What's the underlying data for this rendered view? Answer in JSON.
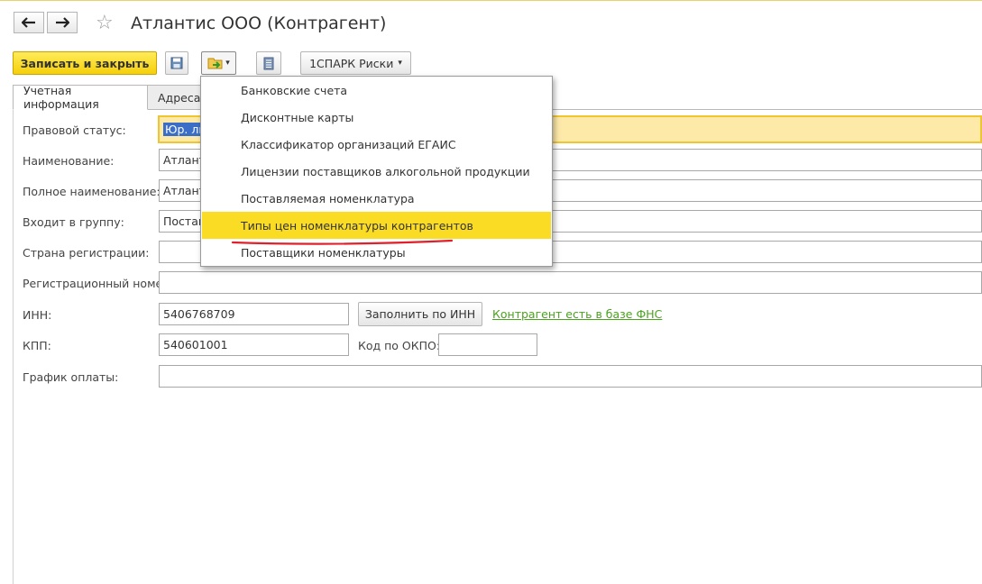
{
  "window": {
    "title": "Атлантис ООО (Контрагент)"
  },
  "nav": {
    "back": "🡐",
    "forward": "🡒"
  },
  "toolbar": {
    "save_close": "Записать и закрыть",
    "spark": "1СПАРК Риски",
    "dropdown_arrow": "▾"
  },
  "tabs": [
    {
      "label": "Учетная информация"
    },
    {
      "label": "Адреса"
    }
  ],
  "form": {
    "legal_status": {
      "label": "Правовой статус:",
      "value": "Юр. лицо"
    },
    "name": {
      "label": "Наименование:",
      "value": "Атлантис ООО"
    },
    "full_name": {
      "label": "Полное наименование:",
      "value": "Атлантис ООО"
    },
    "group": {
      "label": "Входит в группу:",
      "value": "Поставщики"
    },
    "country": {
      "label": "Страна регистрации:",
      "value": ""
    },
    "reg_number": {
      "label": "Регистрационный номер:",
      "value": ""
    },
    "inn": {
      "label": "ИНН:",
      "value": "5406768709"
    },
    "fill_by_inn": "Заполнить по ИНН",
    "fns_link": "Контрагент есть в базе ФНС",
    "kpp": {
      "label": "КПП:",
      "value": "540601001"
    },
    "okpo": {
      "label": "Код по ОКПО:",
      "value": ""
    },
    "payment_schedule": {
      "label": "График оплаты:",
      "value": ""
    }
  },
  "menu": {
    "items": [
      {
        "label": "Банковские счета"
      },
      {
        "label": "Дисконтные карты"
      },
      {
        "label": "Классификатор организаций ЕГАИС"
      },
      {
        "label": "Лицензии поставщиков алкогольной продукции"
      },
      {
        "label": "Поставляемая номенклатура"
      },
      {
        "label": "Типы цен номенклатуры контрагентов"
      },
      {
        "label": "Поставщики номенклатуры"
      }
    ],
    "highlighted_index": 5
  },
  "colors": {
    "accent_yellow": "#fbdc24",
    "link_green": "#4aa21e",
    "underline_red": "#e0202a",
    "selection_blue": "#3b6fc7"
  }
}
